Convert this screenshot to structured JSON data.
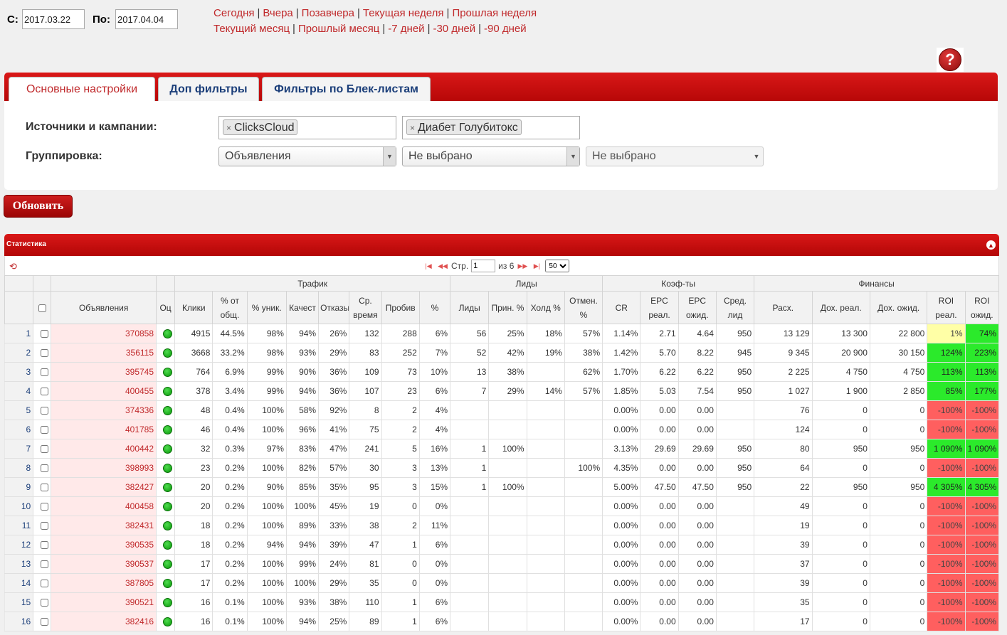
{
  "dates": {
    "from_label": "С:",
    "from_value": "2017.03.22",
    "to_label": "По:",
    "to_value": "2017.04.04"
  },
  "quick_links": {
    "line1": [
      "Сегодня",
      "Вчера",
      "Позавчера",
      "Текущая неделя",
      "Прошлая неделя"
    ],
    "line2": [
      "Текущий месяц",
      "Прошлый месяц",
      "-7 дней",
      "-30 дней",
      "-90 дней"
    ]
  },
  "help_icon": "?",
  "tabs": [
    {
      "label": "Основные настройки",
      "active": true
    },
    {
      "label": "Доп фильтры",
      "active": false
    },
    {
      "label": "Фильтры по Блек-листам",
      "active": false
    }
  ],
  "form": {
    "sources_label": "Источники и кампании:",
    "sources_tags": [
      "ClicksCloud",
      "Диабет Голубитокс"
    ],
    "grouping_label": "Группировка:",
    "grouping_selects": [
      "Объявления",
      "Не выбрано",
      "Не выбрано"
    ],
    "tag_remove": "×",
    "select_arrow": "▼"
  },
  "refresh_button": "Обновить",
  "stats": {
    "title": "Статистика",
    "collapse": "▲",
    "reload": "⟲",
    "pager": {
      "first": "|◀",
      "prev": "◀◀",
      "page_label": "Стр.",
      "page_value": "1",
      "of_label": "из 6",
      "next": "▶▶",
      "last": "▶|",
      "per_page": "50"
    },
    "groups": [
      "Трафик",
      "Лиды",
      "Коэф-ты",
      "Финансы"
    ],
    "columns": [
      "Объявления",
      "Оц",
      "Клики",
      "% от общ.",
      "% уник.",
      "Качест",
      "Отказы",
      "Ср. время",
      "Пробив",
      "%",
      "Лиды",
      "Прин. %",
      "Холд %",
      "Отмен. %",
      "CR",
      "EPC реал.",
      "EPC ожид.",
      "Сред. лид",
      "Расх.",
      "Дох. реал.",
      "Дох. ожид.",
      "ROI реал.",
      "ROI ожид."
    ],
    "rows": [
      [
        "1",
        "370858",
        "4915",
        "44.5%",
        "98%",
        "94%",
        "26%",
        "132",
        "288",
        "6%",
        "56",
        "25%",
        "18%",
        "57%",
        "1.14%",
        "2.71",
        "4.64",
        "950",
        "13 129",
        "13 300",
        "22 800",
        "1%",
        "74%"
      ],
      [
        "2",
        "356115",
        "3668",
        "33.2%",
        "98%",
        "93%",
        "29%",
        "83",
        "252",
        "7%",
        "52",
        "42%",
        "19%",
        "38%",
        "1.42%",
        "5.70",
        "8.22",
        "945",
        "9 345",
        "20 900",
        "30 150",
        "124%",
        "223%"
      ],
      [
        "3",
        "395745",
        "764",
        "6.9%",
        "99%",
        "90%",
        "36%",
        "109",
        "73",
        "10%",
        "13",
        "38%",
        "",
        "62%",
        "1.70%",
        "6.22",
        "6.22",
        "950",
        "2 225",
        "4 750",
        "4 750",
        "113%",
        "113%"
      ],
      [
        "4",
        "400455",
        "378",
        "3.4%",
        "99%",
        "94%",
        "36%",
        "107",
        "23",
        "6%",
        "7",
        "29%",
        "14%",
        "57%",
        "1.85%",
        "5.03",
        "7.54",
        "950",
        "1 027",
        "1 900",
        "2 850",
        "85%",
        "177%"
      ],
      [
        "5",
        "374336",
        "48",
        "0.4%",
        "100%",
        "58%",
        "92%",
        "8",
        "2",
        "4%",
        "",
        "",
        "",
        "",
        "0.00%",
        "0.00",
        "0.00",
        "",
        "76",
        "0",
        "0",
        "-100%",
        "-100%"
      ],
      [
        "6",
        "401785",
        "46",
        "0.4%",
        "100%",
        "96%",
        "41%",
        "75",
        "2",
        "4%",
        "",
        "",
        "",
        "",
        "0.00%",
        "0.00",
        "0.00",
        "",
        "124",
        "0",
        "0",
        "-100%",
        "-100%"
      ],
      [
        "7",
        "400442",
        "32",
        "0.3%",
        "97%",
        "83%",
        "47%",
        "241",
        "5",
        "16%",
        "1",
        "100%",
        "",
        "",
        "3.13%",
        "29.69",
        "29.69",
        "950",
        "80",
        "950",
        "950",
        "1 090%",
        "1 090%"
      ],
      [
        "8",
        "398993",
        "23",
        "0.2%",
        "100%",
        "82%",
        "57%",
        "30",
        "3",
        "13%",
        "1",
        "",
        "",
        "100%",
        "4.35%",
        "0.00",
        "0.00",
        "950",
        "64",
        "0",
        "0",
        "-100%",
        "-100%"
      ],
      [
        "9",
        "382427",
        "20",
        "0.2%",
        "90%",
        "85%",
        "35%",
        "95",
        "3",
        "15%",
        "1",
        "100%",
        "",
        "",
        "5.00%",
        "47.50",
        "47.50",
        "950",
        "22",
        "950",
        "950",
        "4 305%",
        "4 305%"
      ],
      [
        "10",
        "400458",
        "20",
        "0.2%",
        "100%",
        "100%",
        "45%",
        "19",
        "0",
        "0%",
        "",
        "",
        "",
        "",
        "0.00%",
        "0.00",
        "0.00",
        "",
        "49",
        "0",
        "0",
        "-100%",
        "-100%"
      ],
      [
        "11",
        "382431",
        "18",
        "0.2%",
        "100%",
        "89%",
        "33%",
        "38",
        "2",
        "11%",
        "",
        "",
        "",
        "",
        "0.00%",
        "0.00",
        "0.00",
        "",
        "19",
        "0",
        "0",
        "-100%",
        "-100%"
      ],
      [
        "12",
        "390535",
        "18",
        "0.2%",
        "94%",
        "94%",
        "39%",
        "47",
        "1",
        "6%",
        "",
        "",
        "",
        "",
        "0.00%",
        "0.00",
        "0.00",
        "",
        "39",
        "0",
        "0",
        "-100%",
        "-100%"
      ],
      [
        "13",
        "390537",
        "17",
        "0.2%",
        "100%",
        "99%",
        "24%",
        "81",
        "0",
        "0%",
        "",
        "",
        "",
        "",
        "0.00%",
        "0.00",
        "0.00",
        "",
        "37",
        "0",
        "0",
        "-100%",
        "-100%"
      ],
      [
        "14",
        "387805",
        "17",
        "0.2%",
        "100%",
        "100%",
        "29%",
        "35",
        "0",
        "0%",
        "",
        "",
        "",
        "",
        "0.00%",
        "0.00",
        "0.00",
        "",
        "39",
        "0",
        "0",
        "-100%",
        "-100%"
      ],
      [
        "15",
        "390521",
        "16",
        "0.1%",
        "100%",
        "93%",
        "38%",
        "110",
        "1",
        "6%",
        "",
        "",
        "",
        "",
        "0.00%",
        "0.00",
        "0.00",
        "",
        "35",
        "0",
        "0",
        "-100%",
        "-100%"
      ],
      [
        "16",
        "382416",
        "16",
        "0.1%",
        "100%",
        "94%",
        "25%",
        "89",
        "1",
        "6%",
        "",
        "",
        "",
        "",
        "0.00%",
        "0.00",
        "0.00",
        "",
        "17",
        "0",
        "0",
        "-100%",
        "-100%"
      ]
    ]
  },
  "colors": {
    "brand_red": "#c0292b",
    "roi_negative": "#ff5f5f",
    "roi_positive": "#2bea2b",
    "roi_low": "#ffffa6",
    "status_green": "#089808"
  }
}
